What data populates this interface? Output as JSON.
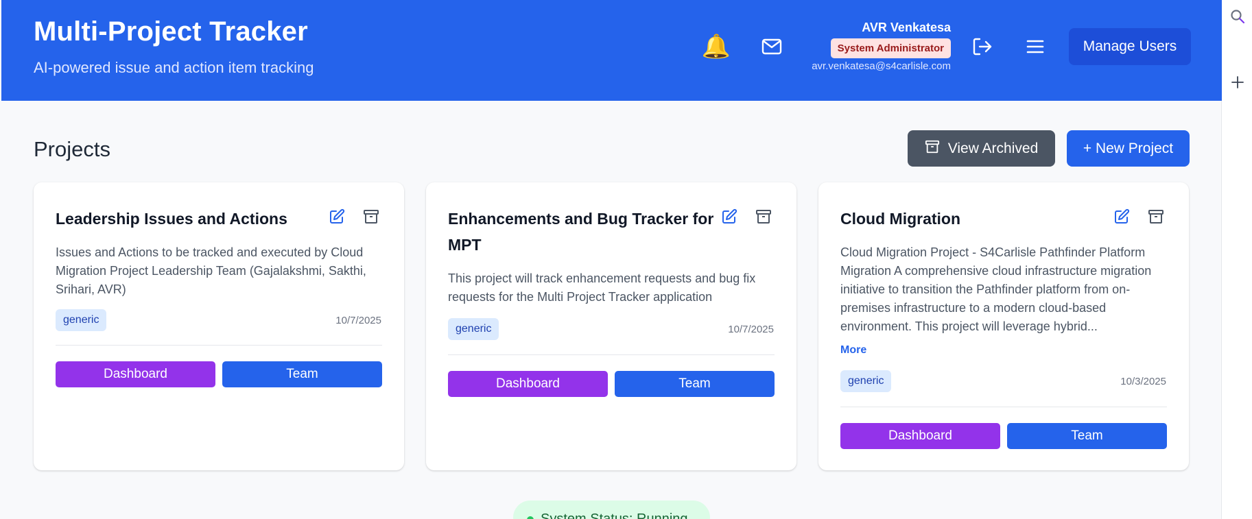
{
  "header": {
    "title": "Multi-Project Tracker",
    "subtitle": "AI-powered issue and action item tracking",
    "user": {
      "name": "AVR Venkatesa",
      "role": "System Administrator",
      "email": "avr.venkatesa@s4carlisle.com"
    },
    "icons": [
      "bell-icon",
      "mail-icon",
      "logout-icon",
      "menu-icon"
    ],
    "manage_users_label": "Manage Users"
  },
  "projects": {
    "heading": "Projects",
    "view_archived_label": "View Archived",
    "new_project_label": "+ New Project",
    "cards": [
      {
        "title": "Leadership Issues and Actions",
        "description": "Issues and Actions to be tracked and executed by Cloud Migration Project Leadership Team (Gajalakshmi, Sakthi, Srihari, AVR)",
        "tag": "generic",
        "date": "10/7/2025",
        "dashboard_label": "Dashboard",
        "team_label": "Team"
      },
      {
        "title": "Enhancements and Bug Tracker for MPT",
        "description": "This project will track enhancement requests and bug fix requests for the Multi Project Tracker application",
        "tag": "generic",
        "date": "10/7/2025",
        "dashboard_label": "Dashboard",
        "team_label": "Team"
      },
      {
        "title": "Cloud Migration",
        "description": "Cloud Migration Project - S4Carlisle Pathfinder Platform Migration A comprehensive cloud infrastructure migration initiative to transition the Pathfinder platform from on-premises infrastructure to a modern cloud-based environment. This project will leverage hybrid...",
        "more_label": "More",
        "tag": "generic",
        "date": "10/3/2025",
        "dashboard_label": "Dashboard",
        "team_label": "Team"
      }
    ]
  },
  "status": {
    "label": "System Status: Running",
    "color": "#22c55e"
  },
  "colors": {
    "header": "#2563eb",
    "primary": "#2563eb",
    "dashboard": "#9333ea",
    "archived_button": "#4b5563",
    "role_badge_bg": "#fee2e2",
    "tag_bg": "#dbeafe"
  }
}
